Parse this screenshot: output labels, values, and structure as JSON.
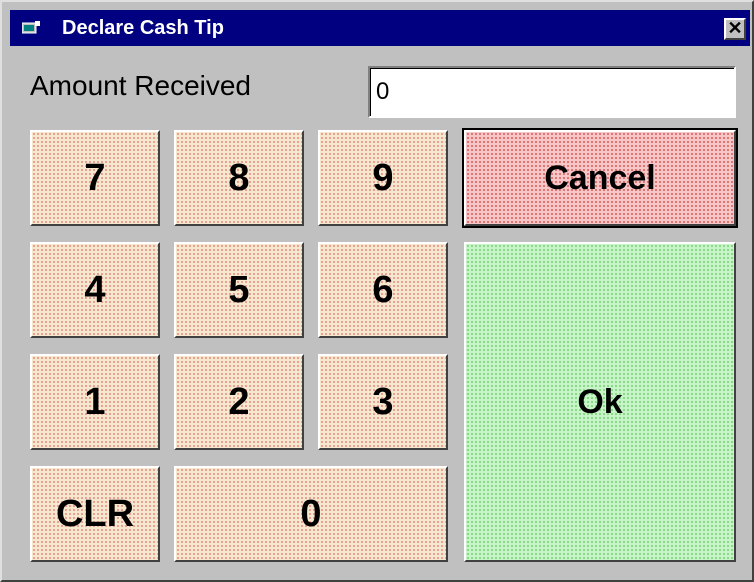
{
  "window": {
    "title": "Declare Cash Tip",
    "close_label": "✕"
  },
  "amount": {
    "label": "Amount Received",
    "value": "0"
  },
  "keypad": {
    "k7": "7",
    "k8": "8",
    "k9": "9",
    "k4": "4",
    "k5": "5",
    "k6": "6",
    "k1": "1",
    "k2": "2",
    "k3": "3",
    "clr": "CLR",
    "k0": "0"
  },
  "actions": {
    "cancel": "Cancel",
    "ok": "Ok"
  },
  "colors": {
    "title_bar": "#000080",
    "number_key": "#f6e8cc",
    "cancel_key": "#f7c7c7",
    "ok_key": "#c8f5c8"
  }
}
